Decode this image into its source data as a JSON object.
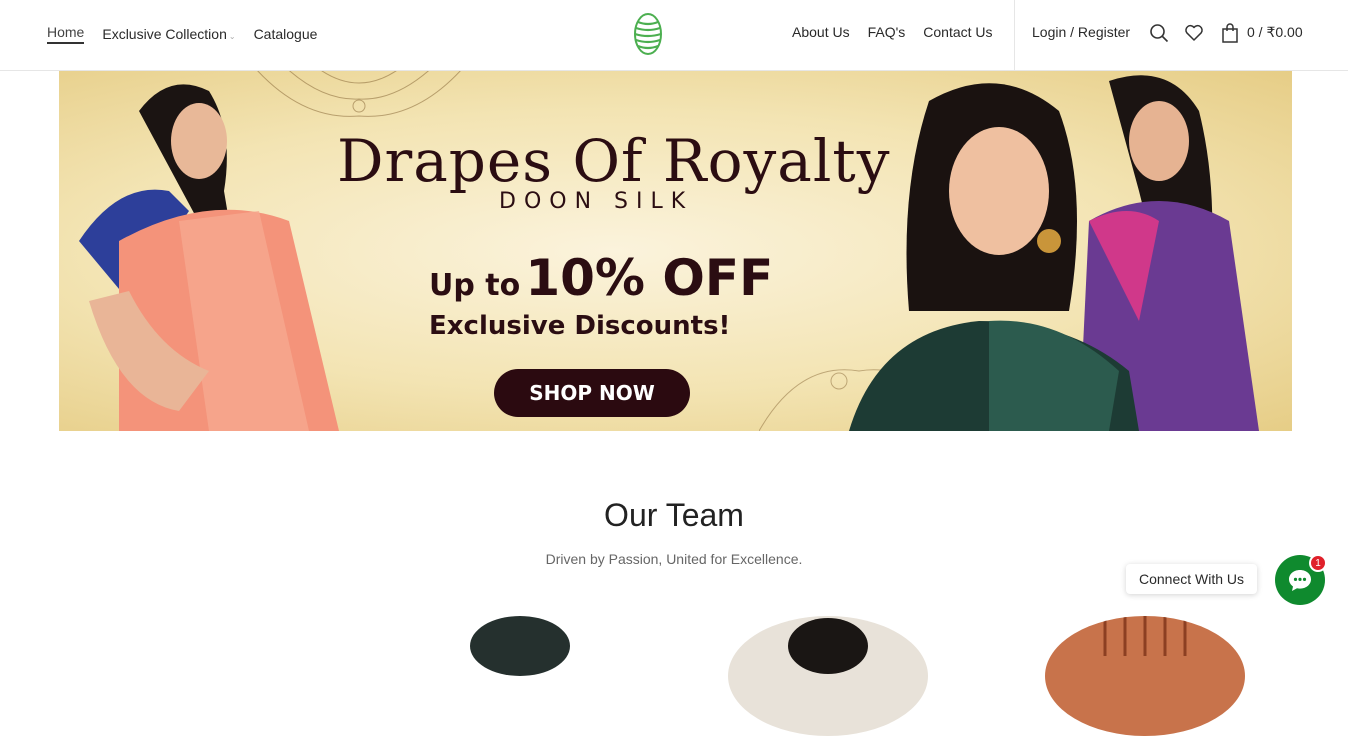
{
  "nav": {
    "home": "Home",
    "exclusive": "Exclusive Collection",
    "catalogue": "Catalogue",
    "about": "About Us",
    "faq": "FAQ's",
    "contact": "Contact Us",
    "login": "Login / Register",
    "cart": "0 / ₹0.00"
  },
  "icons": {
    "logo": "green-cocoon-logo",
    "search": "search-icon",
    "wishlist": "heart-icon",
    "cart": "shopping-bag-icon",
    "chat": "chat-icon"
  },
  "banner": {
    "title": "Drapes Of Royalty",
    "subtitle": "DOON SILK",
    "offer_prefix": "Up to",
    "offer_value": "10% OFF",
    "offer_line": "Exclusive Discounts!",
    "cta": "SHOP NOW"
  },
  "team": {
    "title": "Our Team",
    "subtitle": "Driven by Passion, United for Excellence."
  },
  "chat": {
    "label": "Connect With Us",
    "badge": "1"
  },
  "colors": {
    "brand_green": "#4caf50",
    "banner_text": "#2b0d12",
    "chat_green": "#0f8a2e",
    "badge_red": "#e0202a"
  }
}
